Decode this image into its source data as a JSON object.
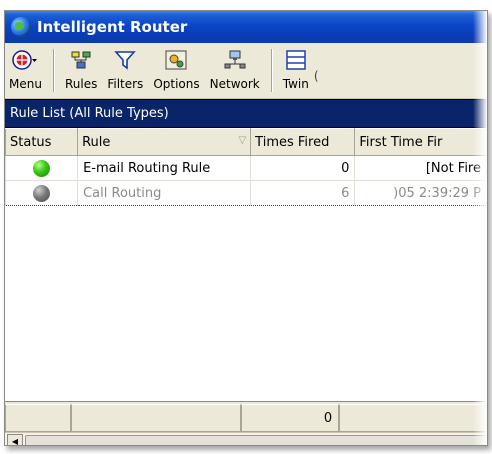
{
  "window": {
    "title": "Intelligent Router"
  },
  "toolbar": {
    "menu_label": "Menu",
    "rules_label": "Rules",
    "filters_label": "Filters",
    "options_label": "Options",
    "network_label": "Network",
    "twin_label": "Twin"
  },
  "rule_list": {
    "header": "Rule List (All Rule Types)",
    "columns": [
      "Status",
      "Rule",
      "Times Fired",
      "First Time Fir"
    ],
    "rows": [
      {
        "status": "green",
        "rule": "E-mail Routing Rule",
        "times_fired": "0",
        "first_time": "[Not Fire"
      },
      {
        "status": "gray",
        "rule": "Call Routing",
        "times_fired": "6",
        "first_time": ")05 2:39:29 P"
      }
    ],
    "footer": {
      "times_fired_total": "0"
    }
  },
  "colors": {
    "title_bar": "#0b46c7",
    "list_header": "#0a246a",
    "status_active": "#3fcc1c",
    "status_inactive": "#7a7a7a"
  }
}
